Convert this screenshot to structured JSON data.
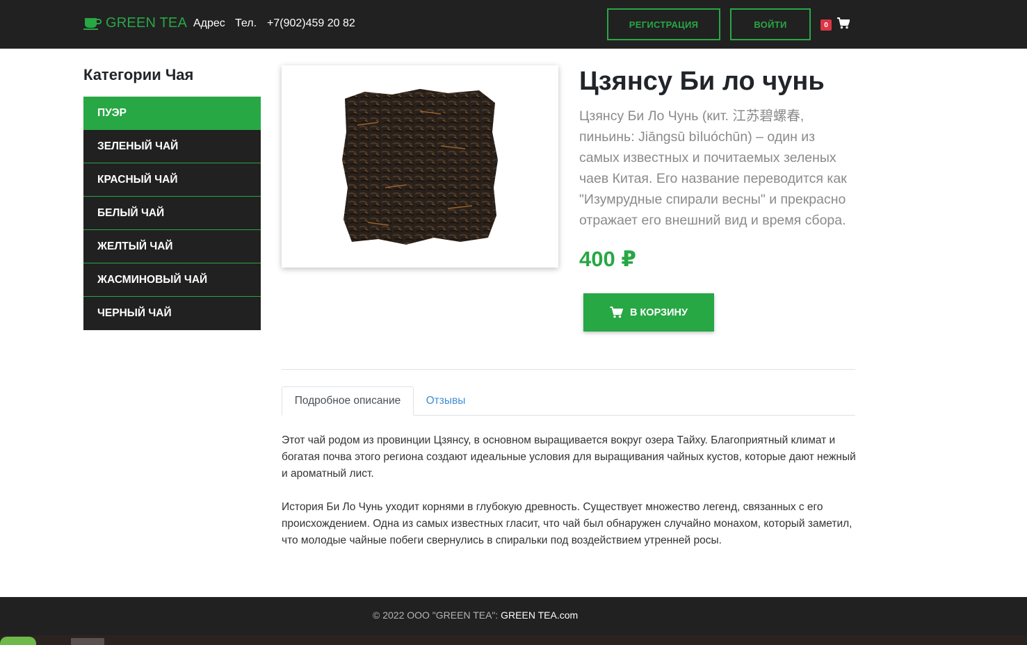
{
  "header": {
    "brand": "GREEN TEA",
    "address_label": "Адрес",
    "phone_label": "Тел.",
    "phone": "+7(902)459 20 82",
    "register_label": "РЕГИСТРАЦИЯ",
    "login_label": "ВОЙТИ",
    "cart_count": "0"
  },
  "sidebar": {
    "title": "Категории Чая",
    "items": [
      {
        "label": "ПУЭР",
        "active": true
      },
      {
        "label": "ЗЕЛЕНЫЙ ЧАЙ"
      },
      {
        "label": "КРАСНЫЙ ЧАЙ"
      },
      {
        "label": "БЕЛЫЙ ЧАЙ"
      },
      {
        "label": "ЖЕЛТЫЙ ЧАЙ"
      },
      {
        "label": "ЖАСМИНОВЫЙ ЧАЙ"
      },
      {
        "label": "ЧЕРНЫЙ ЧАЙ"
      }
    ]
  },
  "product": {
    "title": "Цзянсу Би ло чунь",
    "short_description": "Цзянсу Би Ло Чунь (кит. 江苏碧螺春, пиньинь: Jiāngsū bìluóchūn) – один из самых известных и почитаемых зеленых чаев Китая. Его название переводится как \"Изумрудные спирали весны\" и прекрасно отражает его внешний вид и время сбора.",
    "price": "400 ₽",
    "add_to_cart_label": "В КОРЗИНУ"
  },
  "tabs": [
    {
      "label": "Подробное описание",
      "active": true
    },
    {
      "label": "Отзывы"
    }
  ],
  "details": {
    "paragraph_1": "Этот чай родом из провинции Цзянсу, в основном выращивается вокруг озера Тайху. Благоприятный климат и богатая почва этого региона создают идеальные условия для выращивания чайных кустов, которые дают нежный и ароматный лист.",
    "paragraph_2": "История Би Ло Чунь уходит корнями в глубокую древность. Существует множество легенд, связанных с его происхождением. Одна из самых известных гласит, что чай был обнаружен случайно монахом, который заметил, что молодые чайные побеги свернулись в спиральки под воздействием утренней росы."
  },
  "footer": {
    "copyright": "© 2022 ООО \"GREEN TEA\": ",
    "link": "GREEN TEA.com"
  },
  "colors": {
    "accent": "#28a745",
    "dark": "#212121",
    "badge": "#dc3545",
    "link": "#3d8fd6"
  },
  "icons": [
    "cup-icon",
    "cart-icon"
  ]
}
